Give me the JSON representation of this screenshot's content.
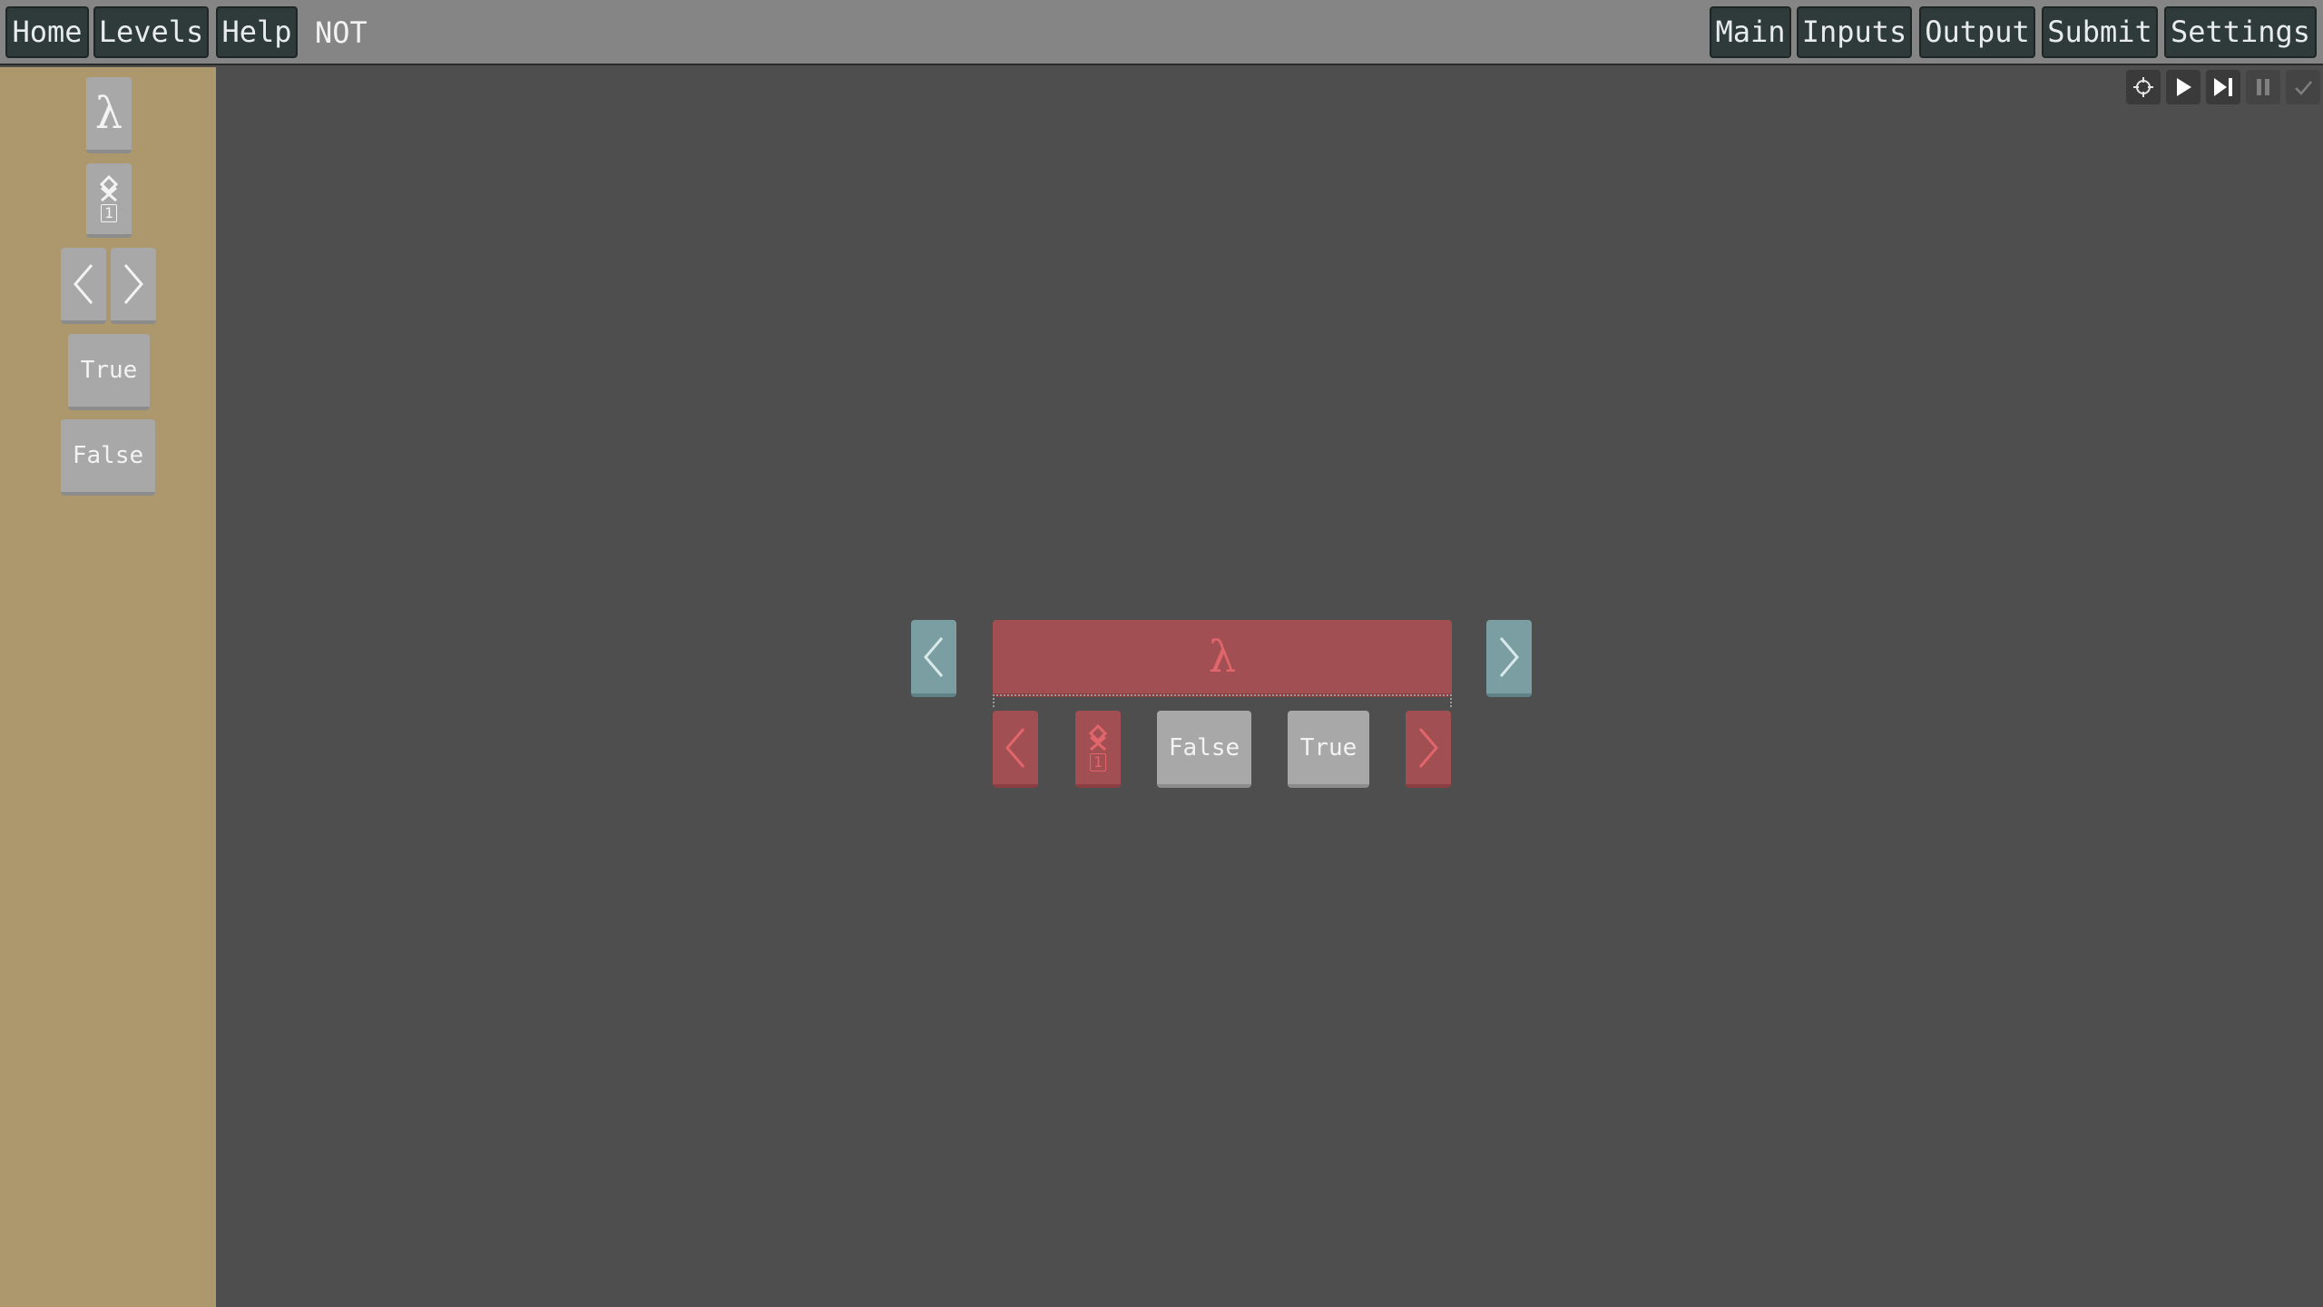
{
  "topbar": {
    "home": "Home",
    "levels": "Levels",
    "help": "Help",
    "level_name": "NOT",
    "main": "Main",
    "inputs": "Inputs",
    "output": "Output",
    "submit": "Submit",
    "settings": "Settings"
  },
  "controls": {
    "icons": [
      "crosshair-icon",
      "play-icon",
      "step-icon",
      "pause-icon",
      "check-icon"
    ]
  },
  "palette": {
    "lambda": "λ",
    "duplicate_count": "1",
    "true_label": "True",
    "false_label": "False"
  },
  "board": {
    "lambda": "λ",
    "duplicate_count": "1",
    "arg1": "False",
    "arg2": "True"
  },
  "colors": {
    "background": "#4e4e4e",
    "topbar": "#858585",
    "sidebar": "#ac986c",
    "lambda_red": "#a24f53",
    "bracket_teal": "#7a9ea2",
    "value_gray": "#a8a8a8"
  }
}
